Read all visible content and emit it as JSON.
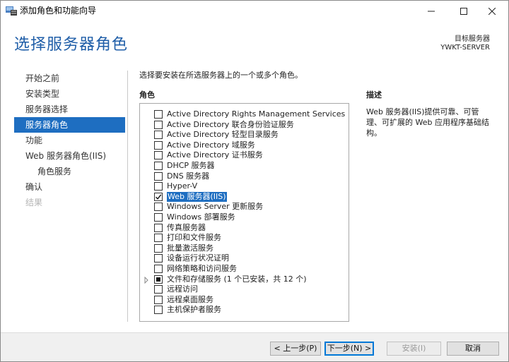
{
  "window": {
    "title": "添加角色和功能向导"
  },
  "header": {
    "page_title": "选择服务器角色",
    "dest_label": "目标服务器",
    "dest_value": "YWKT-SERVER"
  },
  "nav": [
    {
      "label": "开始之前",
      "state": "normal"
    },
    {
      "label": "安装类型",
      "state": "normal"
    },
    {
      "label": "服务器选择",
      "state": "normal"
    },
    {
      "label": "服务器角色",
      "state": "active"
    },
    {
      "label": "功能",
      "state": "normal"
    },
    {
      "label": "Web 服务器角色(IIS)",
      "state": "normal"
    },
    {
      "label": "角色服务",
      "state": "sub"
    },
    {
      "label": "确认",
      "state": "normal"
    },
    {
      "label": "结果",
      "state": "disabled"
    }
  ],
  "content": {
    "instruction": "选择要安装在所选服务器上的一个或多个角色。",
    "roles_heading": "角色",
    "description_heading": "描述",
    "description_text": "Web 服务器(IIS)提供可靠、可管理、可扩展的 Web 应用程序基础结构。"
  },
  "roles": [
    {
      "label": "Active Directory Rights Management Services",
      "state": "unchecked"
    },
    {
      "label": "Active Directory 联合身份验证服务",
      "state": "unchecked"
    },
    {
      "label": "Active Directory 轻型目录服务",
      "state": "unchecked"
    },
    {
      "label": "Active Directory 域服务",
      "state": "unchecked"
    },
    {
      "label": "Active Directory 证书服务",
      "state": "unchecked"
    },
    {
      "label": "DHCP 服务器",
      "state": "unchecked"
    },
    {
      "label": "DNS 服务器",
      "state": "unchecked"
    },
    {
      "label": "Hyper-V",
      "state": "unchecked"
    },
    {
      "label": "Web 服务器(IIS)",
      "state": "checked",
      "selected": true
    },
    {
      "label": "Windows Server 更新服务",
      "state": "unchecked"
    },
    {
      "label": "Windows 部署服务",
      "state": "unchecked"
    },
    {
      "label": "传真服务器",
      "state": "unchecked"
    },
    {
      "label": "打印和文件服务",
      "state": "unchecked"
    },
    {
      "label": "批量激活服务",
      "state": "unchecked"
    },
    {
      "label": "设备运行状况证明",
      "state": "unchecked"
    },
    {
      "label": "网络策略和访问服务",
      "state": "unchecked"
    },
    {
      "label": "文件和存储服务 (1 个已安装，共 12 个)",
      "state": "partial",
      "expandable": true
    },
    {
      "label": "远程访问",
      "state": "unchecked"
    },
    {
      "label": "远程桌面服务",
      "state": "unchecked"
    },
    {
      "label": "主机保护者服务",
      "state": "unchecked"
    }
  ],
  "buttons": {
    "back": "< 上一步(P)",
    "next": "下一步(N) >",
    "install": "安装(I)",
    "cancel": "取消"
  }
}
